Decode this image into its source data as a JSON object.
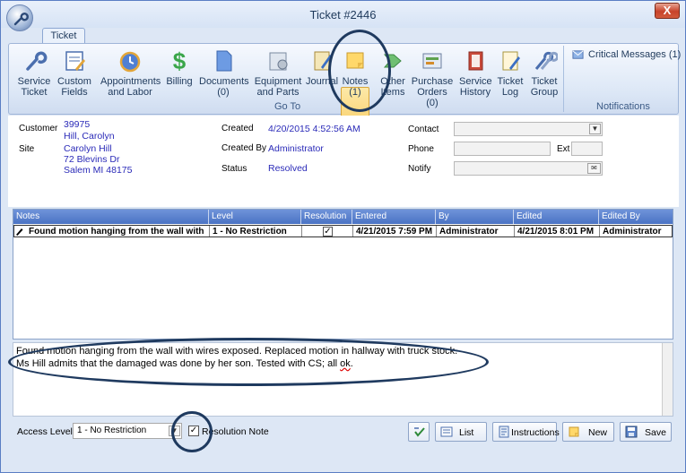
{
  "window": {
    "title": "Ticket #2446",
    "close_label": "X"
  },
  "ribbon": {
    "tab": "Ticket",
    "buttons": [
      {
        "line1": "Service",
        "line2": "Ticket"
      },
      {
        "line1": "Custom",
        "line2": "Fields"
      },
      {
        "line1": "Appointments",
        "line2": "and Labor"
      },
      {
        "line1": "Billing",
        "line2": ""
      },
      {
        "line1": "Documents",
        "line2": "(0)"
      },
      {
        "line1": "Equipment",
        "line2": "and Parts"
      },
      {
        "line1": "Journal",
        "line2": ""
      },
      {
        "line1": "Notes",
        "line2": "(1)"
      },
      {
        "line1": "Other",
        "line2": "Items"
      },
      {
        "line1": "Purchase",
        "line2": "Orders (0)"
      },
      {
        "line1": "Service",
        "line2": "History"
      },
      {
        "line1": "Ticket",
        "line2": "Log"
      },
      {
        "line1": "Ticket",
        "line2": "Group"
      }
    ],
    "group_goto": "Go To",
    "critical_messages": "Critical Messages (1)",
    "group_notifications": "Notifications"
  },
  "info": {
    "customer_label": "Customer",
    "customer_id": "39975",
    "customer_name": "Hill, Carolyn",
    "site_label": "Site",
    "site_name": "Carolyn Hill",
    "site_street": "72 Blevins Dr",
    "site_city": "Salem MI 48175",
    "created_label": "Created",
    "created_value": "4/20/2015 4:52:56 AM",
    "created_by_label": "Created By",
    "created_by_value": "Administrator",
    "status_label": "Status",
    "status_value": "Resolved",
    "contact_label": "Contact",
    "phone_label": "Phone",
    "ext_label": "Ext",
    "notify_label": "Notify"
  },
  "grid": {
    "columns": [
      "Notes",
      "Level",
      "Resolution",
      "Entered",
      "By",
      "Edited",
      "Edited By"
    ],
    "rows": [
      {
        "notes": "Found motion hanging from the wall with wire...",
        "level": "1 - No Restriction",
        "resolution": true,
        "entered": "4/21/2015 7:59 PM",
        "by": "Administrator",
        "edited": "4/21/2015 8:01 PM",
        "edited_by": "Administrator"
      }
    ]
  },
  "note_text": {
    "line1": "Found motion hanging from the wall with wires exposed.  Replaced  motion in hallway with truck stock.",
    "line2_pre": "Ms Hill admits that the damaged was done by her son. Tested with CS; all ",
    "line2_err": "ok",
    "line2_post": "."
  },
  "footer": {
    "access_level_label": "Access Level",
    "access_level_value": "1 - No Restriction",
    "resolution_note_label": "Resolution Note",
    "resolution_note_checked": true,
    "list_label": "List",
    "instructions_label": "Instructions",
    "new_label": "New",
    "save_label": "Save"
  }
}
